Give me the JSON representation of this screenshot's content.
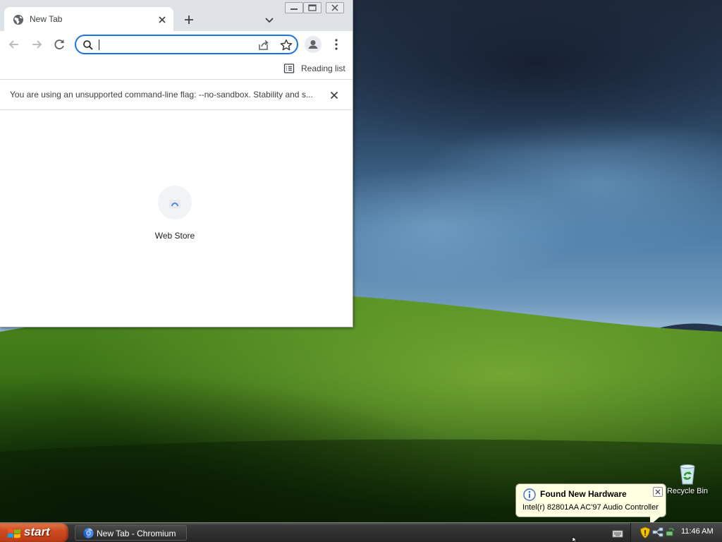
{
  "browser": {
    "tab": {
      "title": "New Tab"
    },
    "toolbar": {
      "omnibox_value": ""
    },
    "bookmarks_bar": {
      "reading_list_label": "Reading list"
    },
    "infobar": {
      "message": "You are using an unsupported command-line flag: --no-sandbox. Stability and s..."
    },
    "ntp": {
      "shortcuts": [
        {
          "label": "Web Store"
        }
      ]
    }
  },
  "desktop": {
    "icons": [
      {
        "label": "Recycle Bin"
      }
    ]
  },
  "notification": {
    "title": "Found New Hardware",
    "text": "Intel(r) 82801AA AC'97 Audio Controller"
  },
  "taskbar": {
    "start_label": "start",
    "tasks": [
      {
        "label": "New Tab - Chromium"
      }
    ],
    "clock": "11:46 AM"
  },
  "colors": {
    "omnibox_focus": "#1a73e8",
    "start_button": "#cf4b22",
    "balloon_bg": "#ffffe1",
    "taskbar": "#303030"
  },
  "icons": [
    "globe-icon",
    "close-icon",
    "plus-icon",
    "chevron-down-icon",
    "back-arrow-icon",
    "forward-arrow-icon",
    "reload-icon",
    "search-icon",
    "share-icon",
    "star-icon",
    "profile-icon",
    "more-vert-icon",
    "reading-list-icon",
    "webstore-icon",
    "recycle-bin-icon",
    "info-icon",
    "windows-flag-icon",
    "chromium-icon",
    "shield-icon",
    "network-icon",
    "safely-remove-icon",
    "keyboard-icon"
  ]
}
